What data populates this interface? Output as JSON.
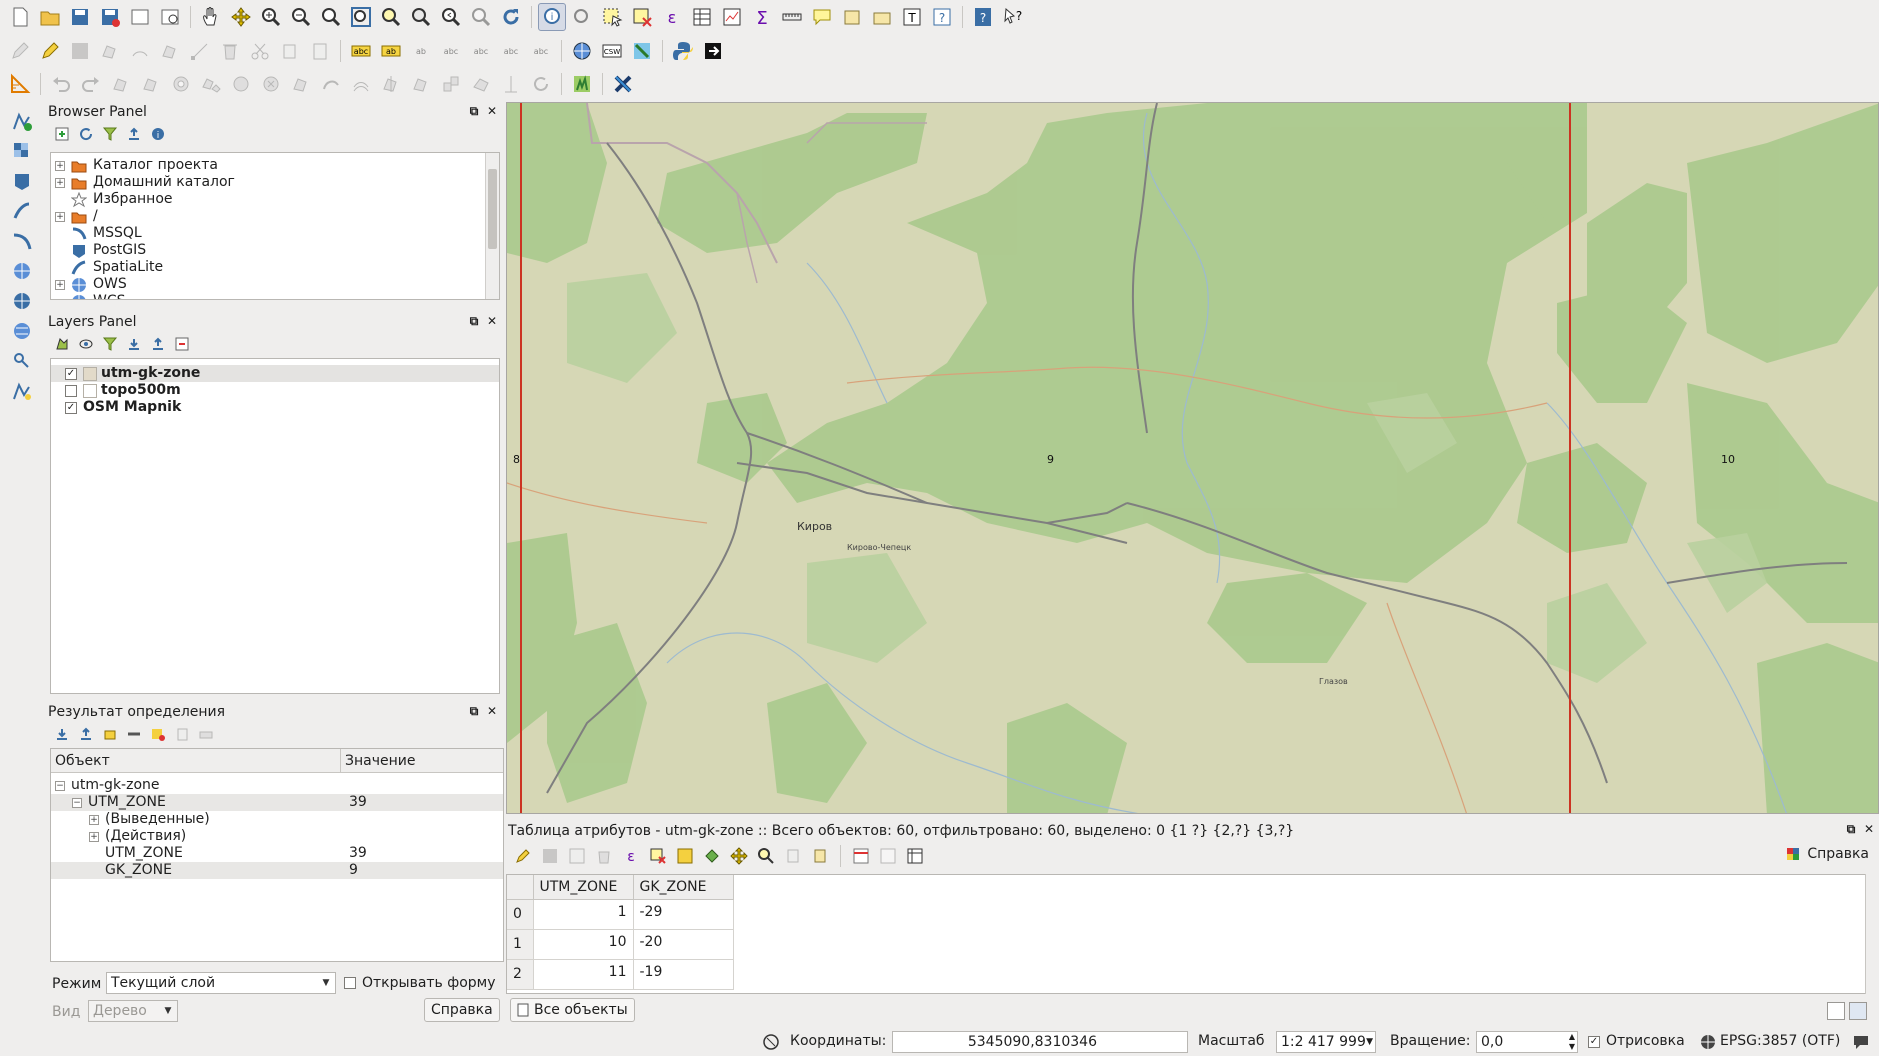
{
  "browser": {
    "title": "Browser Panel",
    "items": [
      {
        "label": "Каталог проекта",
        "icon": "folder-icon",
        "expandable": true
      },
      {
        "label": "Домашний каталог",
        "icon": "folder-icon",
        "expandable": true
      },
      {
        "label": "Избранное",
        "icon": "star-icon",
        "expandable": false
      },
      {
        "label": "/",
        "icon": "folder-icon",
        "expandable": true
      },
      {
        "label": "MSSQL",
        "icon": "mssql-icon",
        "expandable": false
      },
      {
        "label": "PostGIS",
        "icon": "postgis-icon",
        "expandable": false
      },
      {
        "label": "SpatiaLite",
        "icon": "spatialite-icon",
        "expandable": false
      },
      {
        "label": "OWS",
        "icon": "globe-icon",
        "expandable": true
      },
      {
        "label": "WCS",
        "icon": "globe-icon",
        "expandable": false
      }
    ]
  },
  "layers": {
    "title": "Layers Panel",
    "items": [
      {
        "label": "utm-gk-zone",
        "checked": true,
        "swatch": "#e2dac9",
        "selected": true
      },
      {
        "label": "topo500m",
        "checked": false,
        "swatch": "#ffffff",
        "selected": false
      },
      {
        "label": "OSM Mapnik",
        "checked": true,
        "swatch": null,
        "selected": false
      }
    ]
  },
  "identify": {
    "title": "Результат определения",
    "col_object": "Объект",
    "col_value": "Значение",
    "rows": [
      {
        "label": "utm-gk-zone",
        "value": "",
        "indent": 0,
        "expander": "−"
      },
      {
        "label": "UTM_ZONE",
        "value": "39",
        "indent": 1,
        "expander": "−"
      },
      {
        "label": "(Выведенные)",
        "value": "",
        "indent": 2,
        "expander": "+"
      },
      {
        "label": "(Действия)",
        "value": "",
        "indent": 2,
        "expander": "+"
      },
      {
        "label": "UTM_ZONE",
        "value": "39",
        "indent": 2,
        "expander": ""
      },
      {
        "label": "GK_ZONE",
        "value": "9",
        "indent": 2,
        "expander": ""
      }
    ],
    "mode_label": "Режим",
    "mode_value": "Текущий слой",
    "open_form_label": "Открывать форму",
    "view_label": "Вид",
    "view_value": "Дерево",
    "help_button": "Справка"
  },
  "map": {
    "zone_labels": [
      "8",
      "9",
      "10"
    ],
    "place_labels": [
      "Киров",
      "Кирово-Чепецк",
      "Глазов"
    ]
  },
  "attribute_table": {
    "title": "Таблица атрибутов - utm-gk-zone :: Всего объектов: 60, отфильтровано: 60, выделено: 0 {1 ?} {2,?} {3,?}",
    "help_label": "Справка",
    "columns": [
      "UTM_ZONE",
      "GK_ZONE"
    ],
    "rows": [
      {
        "id": "0",
        "utm": "1",
        "gk": "-29"
      },
      {
        "id": "1",
        "utm": "10",
        "gk": "-20"
      },
      {
        "id": "2",
        "utm": "11",
        "gk": "-19"
      }
    ],
    "all_objects_button": "Все объекты"
  },
  "status": {
    "coords_label": "Координаты:",
    "coords_value": "5345090,8310346",
    "scale_label": "Масштаб",
    "scale_value": "1:2 417 999",
    "rotation_label": "Вращение:",
    "rotation_value": "0,0",
    "render_label": "Отрисовка",
    "crs_label": "EPSG:3857 (OTF)"
  },
  "colors": {
    "map_base": "#d6d7b5",
    "forest": "#a9c98c",
    "zone_line": "#cc3322",
    "road": "#777777"
  }
}
